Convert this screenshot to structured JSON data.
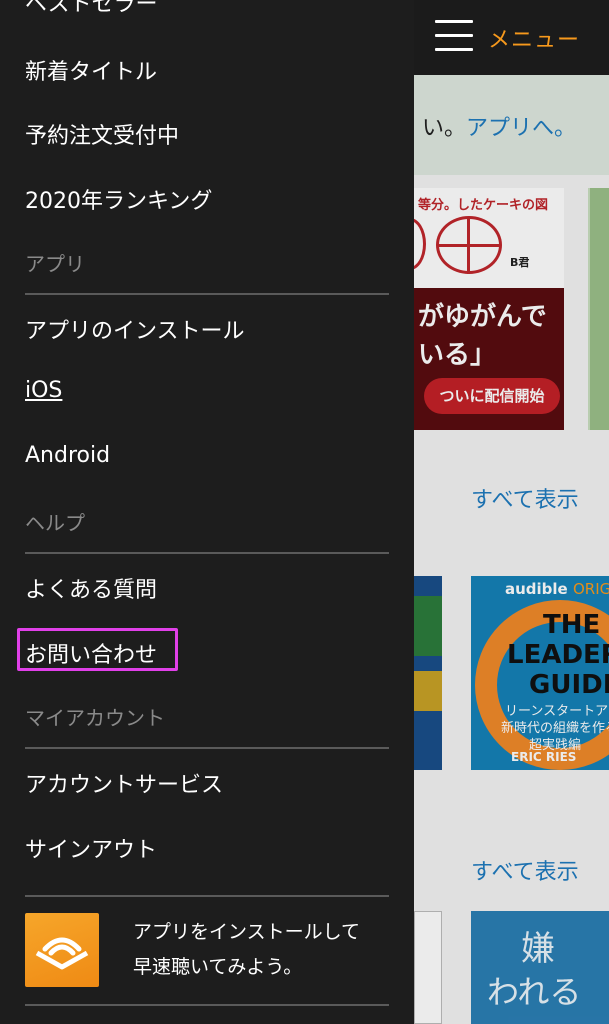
{
  "header": {
    "menu_label": "メニュー"
  },
  "background": {
    "banner_text": "い。",
    "banner_link": "アプリへ。",
    "see_all_1": "すべて表示",
    "see_all_2": "すべて表示",
    "cover_a": {
      "title": "等分。したケーキの図",
      "b_label": "B君",
      "line1": "がゆがんで",
      "line2": "いる」",
      "pill": "ついに配信開始"
    },
    "cover_d": {
      "audible": "audible",
      "original": "ORIGIN",
      "line1": "THE",
      "line2": "LEADER'",
      "line3": "GUIDE",
      "jp1": "リーンスタートア",
      "jp2": "新時代の組織を作る",
      "jp3": "超実践編",
      "author": "ERIC RIES"
    },
    "cover_f": {
      "line1": "嫌",
      "line2": "われる"
    }
  },
  "drawer": {
    "items_top": [
      {
        "label": "ベストセラー"
      },
      {
        "label": "新着タイトル"
      },
      {
        "label": "予約注文受付中"
      },
      {
        "label": "2020年ランキング"
      }
    ],
    "section_app": "アプリ",
    "items_app": [
      {
        "label": "アプリのインストール"
      },
      {
        "label": "iOS"
      },
      {
        "label": "Android"
      }
    ],
    "section_help": "ヘルプ",
    "items_help": [
      {
        "label": "よくある質問"
      },
      {
        "label": "お問い合わせ"
      }
    ],
    "section_account": "マイアカウント",
    "items_account": [
      {
        "label": "アカウントサービス"
      },
      {
        "label": "サインアウト"
      }
    ],
    "install_promo": {
      "line1": "アプリをインストールして",
      "line2": "早速聴いてみよう。"
    }
  },
  "colors": {
    "accent": "#f7991c",
    "link": "#1f7bbf",
    "drawer_bg": "#1d1d1d",
    "highlight": "#e040e8"
  }
}
